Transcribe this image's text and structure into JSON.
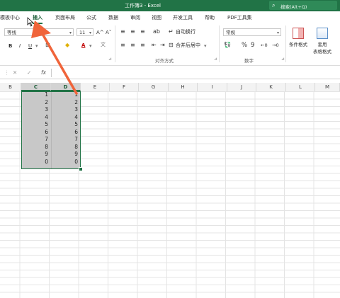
{
  "titlebar": {
    "title": "工作簿3  -  Excel",
    "search_placeholder": "搜索(Alt+Q)",
    "search_icon": "search-icon"
  },
  "tabs": [
    "模板中心",
    "插入",
    "页面布局",
    "公式",
    "数据",
    "审阅",
    "视图",
    "开发工具",
    "帮助",
    "PDF工具集"
  ],
  "active_tab": "插入",
  "ribbon": {
    "font_name": "等线",
    "font_size": "11",
    "grow_font": "A^",
    "shrink_font": "A˅",
    "bold": "B",
    "italic": "I",
    "underline": "U",
    "font_color": "A",
    "wrap_text": "自动换行",
    "merge_center": "合并后居中",
    "alignment_group": "对齐方式",
    "number_format": "常规",
    "percent": "%",
    "comma": "9",
    "number_group": "数字",
    "conditional_format": "条件格式",
    "format_as_table_line1": "套用",
    "format_as_table_line2": "表格格式"
  },
  "formula_bar": {
    "cancel": "✕",
    "enter": "✓",
    "fx": "fx"
  },
  "columns": [
    "B",
    "C",
    "D",
    "E",
    "F",
    "G",
    "H",
    "I",
    "J",
    "K",
    "L",
    "M"
  ],
  "selected_columns": [
    "C",
    "D"
  ],
  "cells": {
    "col_c": [
      1,
      2,
      3,
      4,
      5,
      6,
      7,
      8,
      9,
      0
    ],
    "col_d": [
      1,
      2,
      3,
      4,
      5,
      6,
      7,
      8,
      9,
      0
    ]
  },
  "accent_color": "#217346",
  "annotation_color": "#f0643a"
}
